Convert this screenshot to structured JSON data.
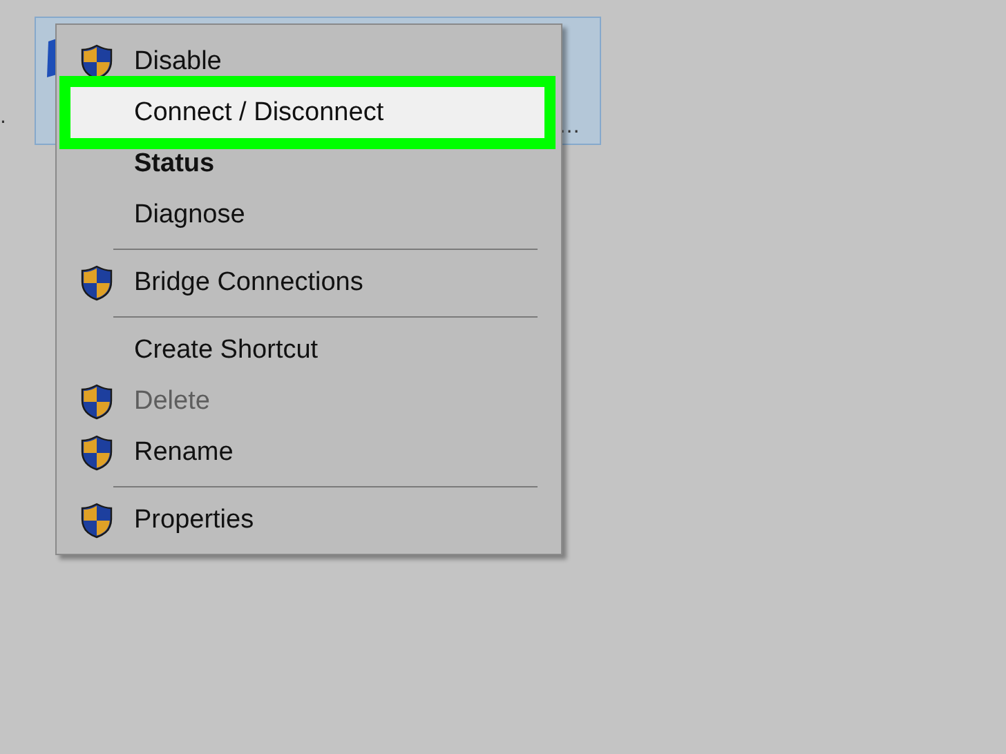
{
  "adapter_tile": {
    "selected": true,
    "name_tail": "…",
    "left_fragment": "."
  },
  "context_menu": {
    "items": [
      {
        "kind": "item",
        "label": "Disable",
        "shield": true,
        "bold": false,
        "disabled": false,
        "selected": false
      },
      {
        "kind": "item",
        "label": "Connect / Disconnect",
        "shield": false,
        "bold": false,
        "disabled": false,
        "selected": true
      },
      {
        "kind": "item",
        "label": "Status",
        "shield": false,
        "bold": true,
        "disabled": false,
        "selected": false
      },
      {
        "kind": "item",
        "label": "Diagnose",
        "shield": false,
        "bold": false,
        "disabled": false,
        "selected": false
      },
      {
        "kind": "separator"
      },
      {
        "kind": "item",
        "label": "Bridge Connections",
        "shield": true,
        "bold": false,
        "disabled": false,
        "selected": false
      },
      {
        "kind": "separator"
      },
      {
        "kind": "item",
        "label": "Create Shortcut",
        "shield": false,
        "bold": false,
        "disabled": false,
        "selected": false
      },
      {
        "kind": "item",
        "label": "Delete",
        "shield": true,
        "bold": false,
        "disabled": true,
        "selected": false
      },
      {
        "kind": "item",
        "label": "Rename",
        "shield": true,
        "bold": false,
        "disabled": false,
        "selected": false
      },
      {
        "kind": "separator"
      },
      {
        "kind": "item",
        "label": "Properties",
        "shield": true,
        "bold": false,
        "disabled": false,
        "selected": false
      }
    ]
  }
}
